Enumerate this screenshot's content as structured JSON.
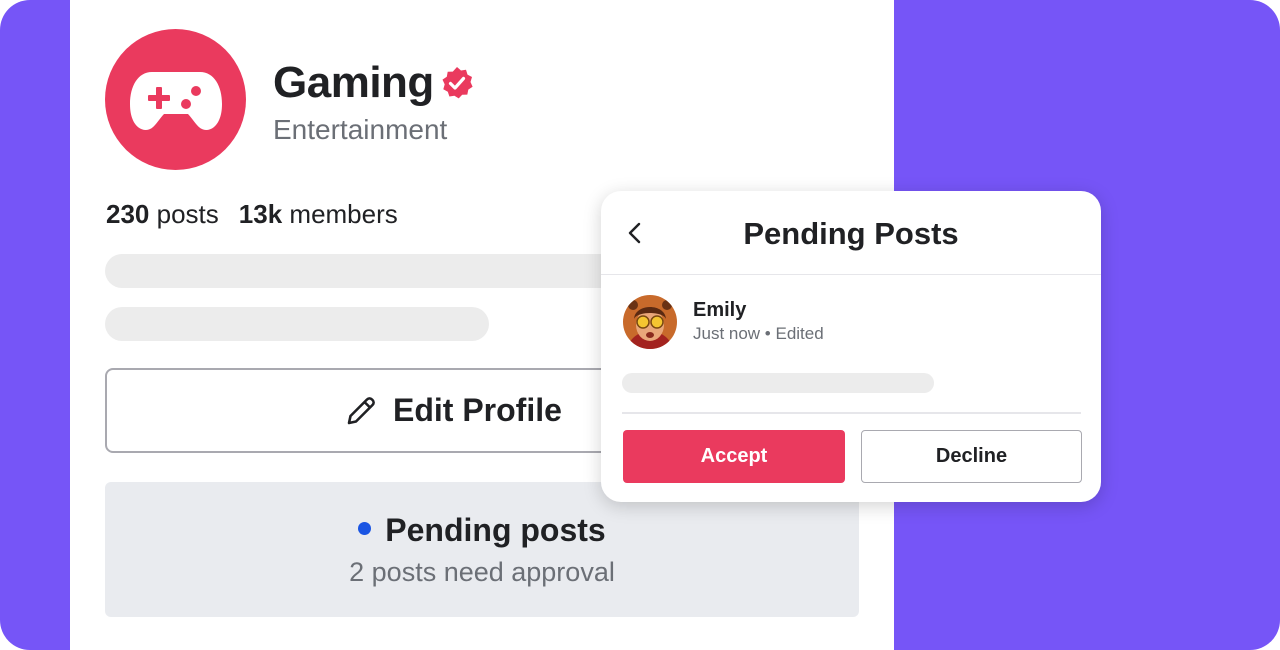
{
  "colors": {
    "background": "#7655f7",
    "accent": "#ea3a5e",
    "status_dot": "#1a55e3",
    "skeleton": "#ececec"
  },
  "profile": {
    "avatar_icon": "gamepad-icon",
    "name": "Gaming",
    "verified_icon": "verified-badge-icon",
    "category": "Entertainment",
    "stats": {
      "posts_count": "230",
      "posts_label": "posts",
      "members_count": "13k",
      "members_label": "members"
    },
    "edit_button": {
      "icon": "pencil-icon",
      "label": "Edit Profile"
    },
    "pending": {
      "title": "Pending posts",
      "subtitle": "2 posts need approval"
    }
  },
  "modal": {
    "back_icon": "chevron-left-icon",
    "title": "Pending Posts",
    "post": {
      "author": "Emily",
      "meta": "Just now • Edited"
    },
    "accept_label": "Accept",
    "decline_label": "Decline"
  }
}
